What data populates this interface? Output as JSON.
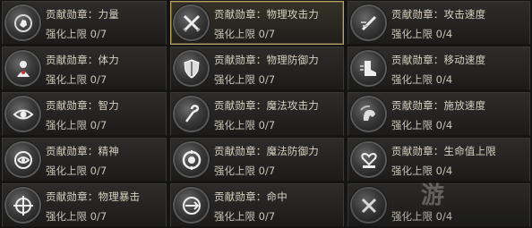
{
  "cards": [
    {
      "title": "贡献勋章：力量",
      "limit": "强化上限 0/7",
      "icon": "fist-icon"
    },
    {
      "title": "贡献勋章：物理攻击力",
      "limit": "强化上限 0/7",
      "icon": "crossed-swords-icon"
    },
    {
      "title": "贡献勋章：攻击速度",
      "limit": "强化上限 0/4",
      "icon": "sword-speed-icon"
    },
    {
      "title": "贡献勋章：体力",
      "limit": "强化上限 0/7",
      "icon": "person-icon"
    },
    {
      "title": "贡献勋章：物理防御力",
      "limit": "强化上限 0/7",
      "icon": "shield-icon"
    },
    {
      "title": "贡献勋章：移动速度",
      "limit": "强化上限 0/4",
      "icon": "boot-icon"
    },
    {
      "title": "贡献勋章：智力",
      "limit": "强化上限 0/7",
      "icon": "eye-icon"
    },
    {
      "title": "贡献勋章：魔法攻击力",
      "limit": "强化上限 0/7",
      "icon": "magic-staff-icon"
    },
    {
      "title": "贡献勋章：施放速度",
      "limit": "强化上限 0/4",
      "icon": "hand-cast-icon"
    },
    {
      "title": "贡献勋章：精神",
      "limit": "强化上限 0/7",
      "icon": "spirit-icon"
    },
    {
      "title": "贡献勋章：魔法防御力",
      "limit": "强化上限 0/7",
      "icon": "magic-shield-icon"
    },
    {
      "title": "贡献勋章：生命值上限",
      "limit": "强化上限 0/4",
      "icon": "heart-icon"
    },
    {
      "title": "贡献勋章：物理暴击",
      "limit": "强化上限 0/7",
      "icon": "crosshair-icon"
    },
    {
      "title": "贡献勋章：命中",
      "limit": "强化上限 0/7",
      "icon": "target-arrow-icon"
    },
    {
      "title": "",
      "limit": "强化上限 0/4",
      "icon": "cross-icon"
    }
  ],
  "selected_index": 1,
  "watermark": "游"
}
